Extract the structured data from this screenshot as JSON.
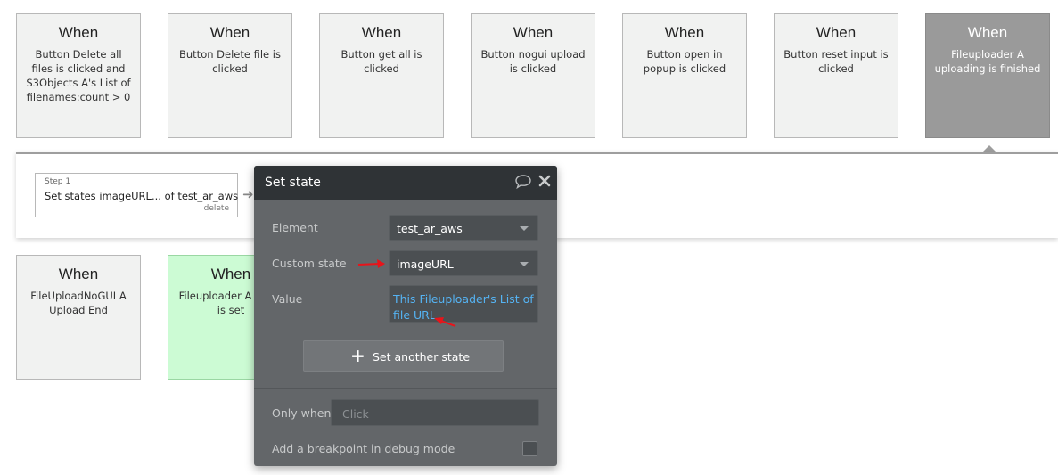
{
  "events_top": [
    {
      "title": "When",
      "description": "Button Delete all files is clicked and S3Objects A's List of filenames:count > 0"
    },
    {
      "title": "When",
      "description": "Button Delete file is clicked"
    },
    {
      "title": "When",
      "description": "Button get all is clicked"
    },
    {
      "title": "When",
      "description": "Button nogui upload is clicked"
    },
    {
      "title": "When",
      "description": "Button open in popup is clicked"
    },
    {
      "title": "When",
      "description": "Button reset input is clicked"
    },
    {
      "title": "When",
      "description": "Fileuploader A uploading is finished"
    }
  ],
  "events_bottom": [
    {
      "title": "When",
      "description": "FileUploadNoGUI A Upload End"
    },
    {
      "title": "When",
      "description": "Fileuploader A value is set"
    }
  ],
  "workflow": {
    "step": {
      "number": "Step 1",
      "name": "Set states imageURL... of test_ar_aws",
      "delete_label": "delete"
    }
  },
  "popup": {
    "title": "Set state",
    "icons": {
      "comment": "comment-icon",
      "close": "close-icon"
    },
    "element_label": "Element",
    "element_value": "test_ar_aws",
    "custom_state_label": "Custom state",
    "custom_state_value": "imageURL",
    "value_label": "Value",
    "value_expression": "This Fileuploader's List of file URL",
    "set_another_state_label": "Set another state",
    "only_when_label": "Only when",
    "only_when_placeholder": "Click",
    "breakpoint_label": "Add a breakpoint in debug mode"
  },
  "colors": {
    "accent_link": "#55b3f3",
    "popup_bg": "#636669",
    "popup_header": "#2f3336",
    "selected_event": "#9a9a9a",
    "green_event": "#ccfbd4",
    "annotation_arrow": "#e8141a"
  }
}
